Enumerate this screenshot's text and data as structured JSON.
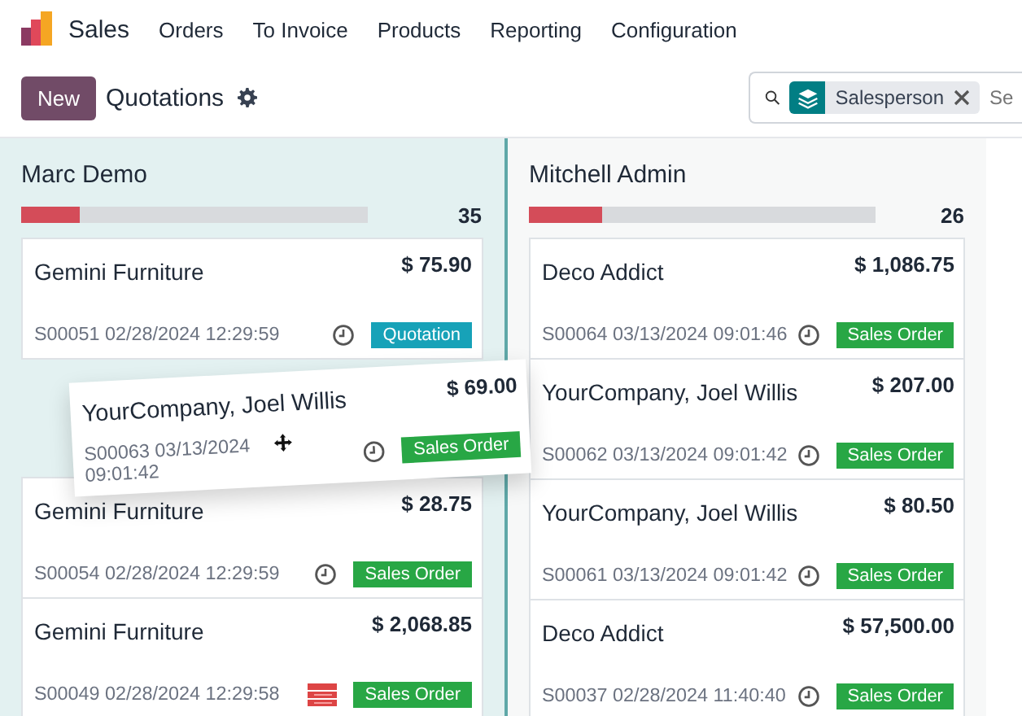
{
  "navbar": {
    "app": "Sales",
    "menu": [
      "Orders",
      "To Invoice",
      "Products",
      "Reporting",
      "Configuration"
    ]
  },
  "control_panel": {
    "new_button": "New",
    "title": "Quotations",
    "search": {
      "facet": "Salesperson",
      "placeholder": "Se"
    }
  },
  "columns": [
    {
      "name": "Marc Demo",
      "count": "35",
      "level": 0.17,
      "selected": true,
      "cards": [
        {
          "kind": "card",
          "customer": "Gemini Furniture",
          "amount": "$ 75.90",
          "ref": "S00051 02/28/2024 12:29:59",
          "activity_overdue": false,
          "status": {
            "label": "Quotation",
            "color": "#17a2b8"
          }
        },
        {
          "kind": "drop-slot"
        },
        {
          "kind": "card",
          "customer": "Gemini Furniture",
          "amount": "$ 28.75",
          "ref": "S00054 02/28/2024 12:29:59",
          "activity_overdue": false,
          "status": {
            "label": "Sales Order",
            "color": "#28a745"
          }
        },
        {
          "kind": "card",
          "customer": "Gemini Furniture",
          "amount": "$ 2,068.85",
          "ref": "S00049 02/28/2024 12:29:58",
          "activity_overdue": true,
          "status": {
            "label": "Sales Order",
            "color": "#28a745"
          }
        }
      ]
    },
    {
      "name": "Mitchell Admin",
      "count": "26",
      "level": 0.21,
      "selected": false,
      "cards": [
        {
          "kind": "card",
          "customer": "Deco Addict",
          "amount": "$ 1,086.75",
          "ref": "S00064 03/13/2024 09:01:46",
          "activity_overdue": false,
          "status": {
            "label": "Sales Order",
            "color": "#28a745"
          }
        },
        {
          "kind": "card",
          "customer": "YourCompany, Joel Willis",
          "amount": "$ 207.00",
          "ref": "S00062 03/13/2024 09:01:42",
          "activity_overdue": false,
          "status": {
            "label": "Sales Order",
            "color": "#28a745"
          }
        },
        {
          "kind": "card",
          "customer": "YourCompany, Joel Willis",
          "amount": "$ 80.50",
          "ref": "S00061 03/13/2024 09:01:42",
          "activity_overdue": false,
          "status": {
            "label": "Sales Order",
            "color": "#28a745"
          }
        },
        {
          "kind": "card",
          "customer": "Deco Addict",
          "amount": "$ 57,500.00",
          "ref": "S00037 02/28/2024 11:40:40",
          "activity_overdue": false,
          "status": {
            "label": "Sales Order",
            "color": "#28a745"
          }
        }
      ]
    }
  ],
  "dragged_card": {
    "customer": "YourCompany, Joel Willis",
    "amount": "$ 69.00",
    "ref": "S00063 03/13/2024 09:01:42",
    "activity_overdue": false,
    "status": {
      "label": "Sales Order",
      "color": "#28a745"
    }
  }
}
